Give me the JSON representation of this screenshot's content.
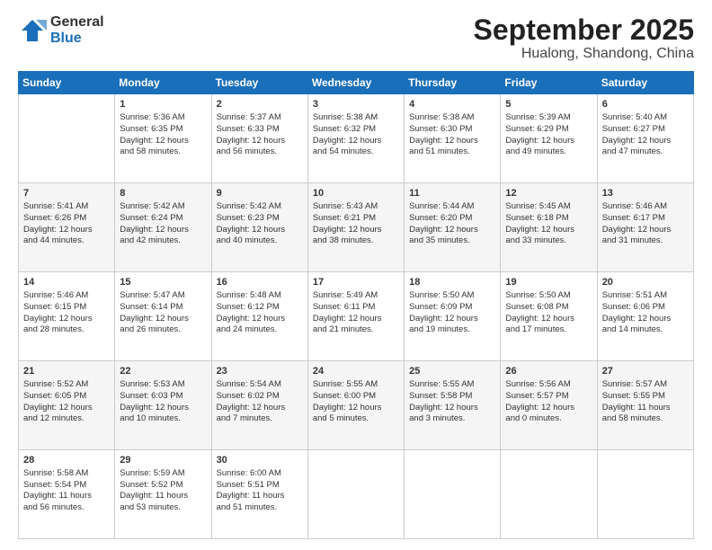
{
  "header": {
    "logo_general": "General",
    "logo_blue": "Blue",
    "month_title": "September 2025",
    "subtitle": "Hualong, Shandong, China"
  },
  "days_of_week": [
    "Sunday",
    "Monday",
    "Tuesday",
    "Wednesday",
    "Thursday",
    "Friday",
    "Saturday"
  ],
  "weeks": [
    [
      {
        "day": "",
        "text": ""
      },
      {
        "day": "1",
        "text": "Sunrise: 5:36 AM\nSunset: 6:35 PM\nDaylight: 12 hours\nand 58 minutes."
      },
      {
        "day": "2",
        "text": "Sunrise: 5:37 AM\nSunset: 6:33 PM\nDaylight: 12 hours\nand 56 minutes."
      },
      {
        "day": "3",
        "text": "Sunrise: 5:38 AM\nSunset: 6:32 PM\nDaylight: 12 hours\nand 54 minutes."
      },
      {
        "day": "4",
        "text": "Sunrise: 5:38 AM\nSunset: 6:30 PM\nDaylight: 12 hours\nand 51 minutes."
      },
      {
        "day": "5",
        "text": "Sunrise: 5:39 AM\nSunset: 6:29 PM\nDaylight: 12 hours\nand 49 minutes."
      },
      {
        "day": "6",
        "text": "Sunrise: 5:40 AM\nSunset: 6:27 PM\nDaylight: 12 hours\nand 47 minutes."
      }
    ],
    [
      {
        "day": "7",
        "text": "Sunrise: 5:41 AM\nSunset: 6:26 PM\nDaylight: 12 hours\nand 44 minutes."
      },
      {
        "day": "8",
        "text": "Sunrise: 5:42 AM\nSunset: 6:24 PM\nDaylight: 12 hours\nand 42 minutes."
      },
      {
        "day": "9",
        "text": "Sunrise: 5:42 AM\nSunset: 6:23 PM\nDaylight: 12 hours\nand 40 minutes."
      },
      {
        "day": "10",
        "text": "Sunrise: 5:43 AM\nSunset: 6:21 PM\nDaylight: 12 hours\nand 38 minutes."
      },
      {
        "day": "11",
        "text": "Sunrise: 5:44 AM\nSunset: 6:20 PM\nDaylight: 12 hours\nand 35 minutes."
      },
      {
        "day": "12",
        "text": "Sunrise: 5:45 AM\nSunset: 6:18 PM\nDaylight: 12 hours\nand 33 minutes."
      },
      {
        "day": "13",
        "text": "Sunrise: 5:46 AM\nSunset: 6:17 PM\nDaylight: 12 hours\nand 31 minutes."
      }
    ],
    [
      {
        "day": "14",
        "text": "Sunrise: 5:46 AM\nSunset: 6:15 PM\nDaylight: 12 hours\nand 28 minutes."
      },
      {
        "day": "15",
        "text": "Sunrise: 5:47 AM\nSunset: 6:14 PM\nDaylight: 12 hours\nand 26 minutes."
      },
      {
        "day": "16",
        "text": "Sunrise: 5:48 AM\nSunset: 6:12 PM\nDaylight: 12 hours\nand 24 minutes."
      },
      {
        "day": "17",
        "text": "Sunrise: 5:49 AM\nSunset: 6:11 PM\nDaylight: 12 hours\nand 21 minutes."
      },
      {
        "day": "18",
        "text": "Sunrise: 5:50 AM\nSunset: 6:09 PM\nDaylight: 12 hours\nand 19 minutes."
      },
      {
        "day": "19",
        "text": "Sunrise: 5:50 AM\nSunset: 6:08 PM\nDaylight: 12 hours\nand 17 minutes."
      },
      {
        "day": "20",
        "text": "Sunrise: 5:51 AM\nSunset: 6:06 PM\nDaylight: 12 hours\nand 14 minutes."
      }
    ],
    [
      {
        "day": "21",
        "text": "Sunrise: 5:52 AM\nSunset: 6:05 PM\nDaylight: 12 hours\nand 12 minutes."
      },
      {
        "day": "22",
        "text": "Sunrise: 5:53 AM\nSunset: 6:03 PM\nDaylight: 12 hours\nand 10 minutes."
      },
      {
        "day": "23",
        "text": "Sunrise: 5:54 AM\nSunset: 6:02 PM\nDaylight: 12 hours\nand 7 minutes."
      },
      {
        "day": "24",
        "text": "Sunrise: 5:55 AM\nSunset: 6:00 PM\nDaylight: 12 hours\nand 5 minutes."
      },
      {
        "day": "25",
        "text": "Sunrise: 5:55 AM\nSunset: 5:58 PM\nDaylight: 12 hours\nand 3 minutes."
      },
      {
        "day": "26",
        "text": "Sunrise: 5:56 AM\nSunset: 5:57 PM\nDaylight: 12 hours\nand 0 minutes."
      },
      {
        "day": "27",
        "text": "Sunrise: 5:57 AM\nSunset: 5:55 PM\nDaylight: 11 hours\nand 58 minutes."
      }
    ],
    [
      {
        "day": "28",
        "text": "Sunrise: 5:58 AM\nSunset: 5:54 PM\nDaylight: 11 hours\nand 56 minutes."
      },
      {
        "day": "29",
        "text": "Sunrise: 5:59 AM\nSunset: 5:52 PM\nDaylight: 11 hours\nand 53 minutes."
      },
      {
        "day": "30",
        "text": "Sunrise: 6:00 AM\nSunset: 5:51 PM\nDaylight: 11 hours\nand 51 minutes."
      },
      {
        "day": "",
        "text": ""
      },
      {
        "day": "",
        "text": ""
      },
      {
        "day": "",
        "text": ""
      },
      {
        "day": "",
        "text": ""
      }
    ]
  ]
}
